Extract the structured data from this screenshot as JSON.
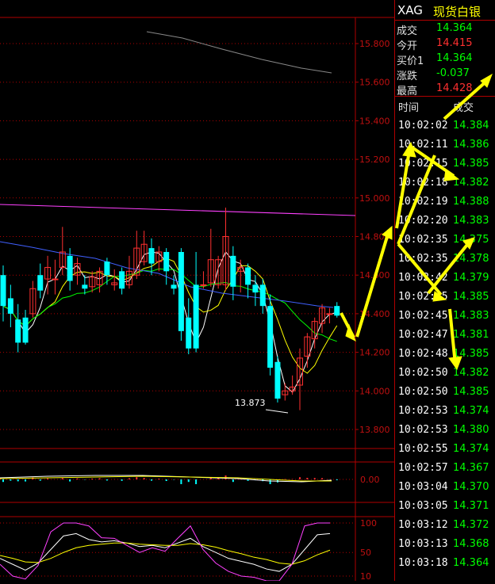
{
  "quote_panel": {
    "symbol": "XAG",
    "name": "现货白银",
    "rows": [
      {
        "label": "成交",
        "value": "14.364",
        "color": "#00ff00"
      },
      {
        "label": "今开",
        "value": "14.415",
        "color": "#ff3030"
      },
      {
        "label": "买价1",
        "value": "14.364",
        "color": "#00ff00"
      },
      {
        "label": "涨跌",
        "value": "-0.037",
        "color": "#00ff00"
      },
      {
        "label": "最高",
        "value": "14.428",
        "color": "#ff3030"
      }
    ]
  },
  "ticks": {
    "time_header": "时间",
    "price_header": "成交",
    "rows": [
      {
        "time": "10:02:02",
        "price": "14.384"
      },
      {
        "time": "10:02:11",
        "price": "14.386"
      },
      {
        "time": "10:02:15",
        "price": "14.385"
      },
      {
        "time": "10:02:18",
        "price": "14.382"
      },
      {
        "time": "10:02:19",
        "price": "14.388"
      },
      {
        "time": "10:02:20",
        "price": "14.383"
      },
      {
        "time": "10:02:35",
        "price": "14.375"
      },
      {
        "time": "10:02:35",
        "price": "14.378"
      },
      {
        "time": "10:02:42",
        "price": "14.379"
      },
      {
        "time": "10:02:45",
        "price": "14.385"
      },
      {
        "time": "10:02:45",
        "price": "14.383"
      },
      {
        "time": "10:02:47",
        "price": "14.381"
      },
      {
        "time": "10:02:48",
        "price": "14.385"
      },
      {
        "time": "10:02:50",
        "price": "14.382"
      },
      {
        "time": "10:02:50",
        "price": "14.385"
      },
      {
        "time": "10:02:53",
        "price": "14.374"
      },
      {
        "time": "10:02:53",
        "price": "14.380"
      },
      {
        "time": "10:02:55",
        "price": "14.374"
      },
      {
        "time": "10:02:57",
        "price": "14.367"
      },
      {
        "time": "10:03:04",
        "price": "14.370"
      },
      {
        "time": "10:03:05",
        "price": "14.371"
      },
      {
        "time": "10:03:12",
        "price": "14.372"
      },
      {
        "time": "10:03:13",
        "price": "14.368"
      },
      {
        "time": "10:03:18",
        "price": "14.364"
      }
    ]
  },
  "chart_data": {
    "type": "candlestick",
    "main_axis": {
      "ticks": [
        "15.800",
        "15.600",
        "15.400",
        "15.200",
        "15.000",
        "14.800",
        "14.600",
        "14.400",
        "14.200",
        "14.000",
        "13.800"
      ],
      "ylim": [
        13.7,
        15.93
      ]
    },
    "low_label": "13.873",
    "candles": [
      [
        14.6,
        14.44,
        14.65,
        14.36
      ],
      [
        14.48,
        14.4,
        14.55,
        14.33
      ],
      [
        14.37,
        14.25,
        14.45,
        14.2
      ],
      [
        14.38,
        14.25,
        14.42,
        14.24
      ],
      [
        14.4,
        14.53,
        14.57,
        14.38
      ],
      [
        14.6,
        14.52,
        14.66,
        14.48
      ],
      [
        14.58,
        14.64,
        14.7,
        14.5
      ],
      [
        14.58,
        14.58,
        14.68,
        14.5
      ],
      [
        14.64,
        14.72,
        14.85,
        14.6
      ],
      [
        14.7,
        14.57,
        14.74,
        14.52
      ],
      [
        14.6,
        14.66,
        14.69,
        14.55
      ],
      [
        14.55,
        14.53,
        14.6,
        14.5
      ],
      [
        14.54,
        14.59,
        14.62,
        14.51
      ],
      [
        14.55,
        14.62,
        14.64,
        14.51
      ],
      [
        14.67,
        14.6,
        14.69,
        14.55
      ],
      [
        14.55,
        14.56,
        14.63,
        14.52
      ],
      [
        14.62,
        14.53,
        14.64,
        14.5
      ],
      [
        14.55,
        14.62,
        14.7,
        14.53
      ],
      [
        14.6,
        14.74,
        14.83,
        14.58
      ],
      [
        14.67,
        14.76,
        14.83,
        14.65
      ],
      [
        14.74,
        14.66,
        14.79,
        14.6
      ],
      [
        14.67,
        14.72,
        14.75,
        14.62
      ],
      [
        14.72,
        14.62,
        14.74,
        14.55
      ],
      [
        14.55,
        14.53,
        14.6,
        14.5
      ],
      [
        14.72,
        14.31,
        14.74,
        14.26
      ],
      [
        14.38,
        14.22,
        14.48,
        14.19
      ],
      [
        14.55,
        14.22,
        14.72,
        14.2
      ],
      [
        14.55,
        14.55,
        14.62,
        14.53
      ],
      [
        14.56,
        14.68,
        14.84,
        14.54
      ],
      [
        14.55,
        14.68,
        14.7,
        14.53
      ],
      [
        14.55,
        14.8,
        14.95,
        14.52
      ],
      [
        14.7,
        14.54,
        14.75,
        14.47
      ],
      [
        14.62,
        14.64,
        14.68,
        14.51
      ],
      [
        14.64,
        14.55,
        14.66,
        14.48
      ],
      [
        14.55,
        14.51,
        14.6,
        14.44
      ],
      [
        14.55,
        14.44,
        14.58,
        14.4
      ],
      [
        14.44,
        14.12,
        14.5,
        14.08
      ],
      [
        14.15,
        13.96,
        14.18,
        13.94
      ],
      [
        13.98,
        14.0,
        14.04,
        13.95
      ],
      [
        14.0,
        14.02,
        14.08,
        13.98
      ],
      [
        14.03,
        14.17,
        14.22,
        13.9
      ],
      [
        14.18,
        14.28,
        14.3,
        14.12
      ],
      [
        14.27,
        14.36,
        14.38,
        14.22
      ],
      [
        14.35,
        14.43,
        14.45,
        14.3
      ],
      [
        14.4,
        14.4,
        14.43,
        14.35
      ],
      [
        14.44,
        14.39,
        14.46,
        14.38
      ]
    ],
    "ma_colors": {
      "white": "#ffffff",
      "yellow": "#ffff00",
      "magenta": "#ff40ff",
      "green": "#00ff00",
      "blue": "#4060ff",
      "gray": "#888888"
    },
    "macd_axis": {
      "ticks": [
        "0.00"
      ]
    },
    "kdj_axis": {
      "ticks": [
        "100",
        "50",
        "10"
      ]
    }
  }
}
